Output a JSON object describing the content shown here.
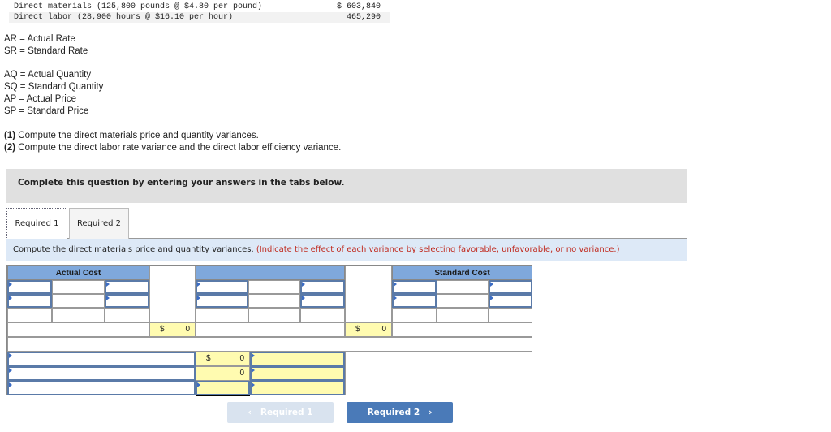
{
  "given": [
    {
      "label": "Direct materials (125,800 pounds @ $4.80 per pound)",
      "amount": "$ 603,840"
    },
    {
      "label": "Direct labor (28,900 hours @ $16.10 per hour)",
      "amount": "465,290"
    }
  ],
  "definitions_rate": [
    "AR = Actual Rate",
    "SR = Standard Rate"
  ],
  "definitions_qty": [
    "AQ = Actual Quantity",
    "SQ = Standard Quantity",
    "AP = Actual Price",
    "SP = Standard Price"
  ],
  "questions": [
    {
      "num": "(1)",
      "text": " Compute the direct materials price and quantity variances."
    },
    {
      "num": "(2)",
      "text": " Compute the direct labor rate variance and the direct labor efficiency variance."
    }
  ],
  "banner": "Complete this question by entering your answers in the tabs below.",
  "tabs": [
    {
      "label": "Required 1",
      "active": true
    },
    {
      "label": "Required 2",
      "active": false
    }
  ],
  "instruction": {
    "main": "Compute the direct materials price and quantity variances. ",
    "note": "(Indicate the effect of each variance by selecting favorable, unfavorable, or no variance.)"
  },
  "table": {
    "headers": {
      "actual_cost": "Actual Cost",
      "middle": "",
      "standard_cost": "Standard Cost"
    },
    "totals": [
      {
        "currency": "$",
        "value": "0"
      },
      {
        "currency": "$",
        "value": "0"
      }
    ],
    "variances": [
      {
        "currency": "$",
        "value": "0"
      },
      {
        "currency": "",
        "value": "0"
      }
    ]
  },
  "nav": {
    "prev_label": "Required 1",
    "next_label": "Required 2",
    "prev_icon": "‹",
    "next_icon": "›"
  }
}
